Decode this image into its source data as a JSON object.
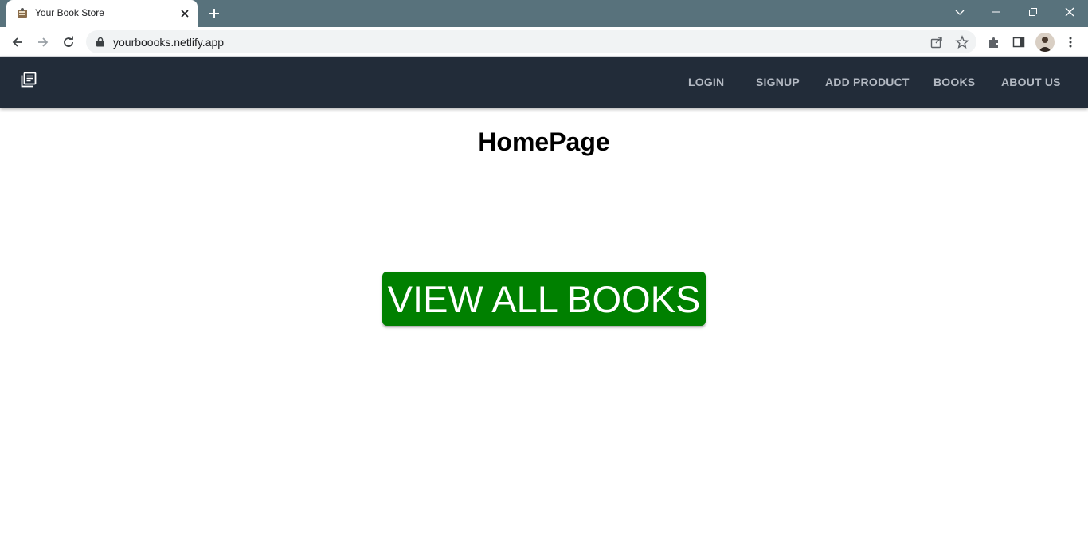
{
  "browser": {
    "tab_title": "Your Book Store",
    "url": "yourboooks.netlify.app"
  },
  "navbar": {
    "links": [
      {
        "label": "LOGIN"
      },
      {
        "label": "SIGNUP"
      },
      {
        "label": "ADD PRODUCT"
      },
      {
        "label": "BOOKS"
      },
      {
        "label": "ABOUT US"
      }
    ]
  },
  "main": {
    "title": "HomePage",
    "cta_label": "VIEW ALL BOOKS"
  },
  "colors": {
    "tabbar_bg": "#58727c",
    "navbar_bg": "#222c39",
    "nav_link": "#b3b9c2",
    "cta_bg": "#008000"
  }
}
